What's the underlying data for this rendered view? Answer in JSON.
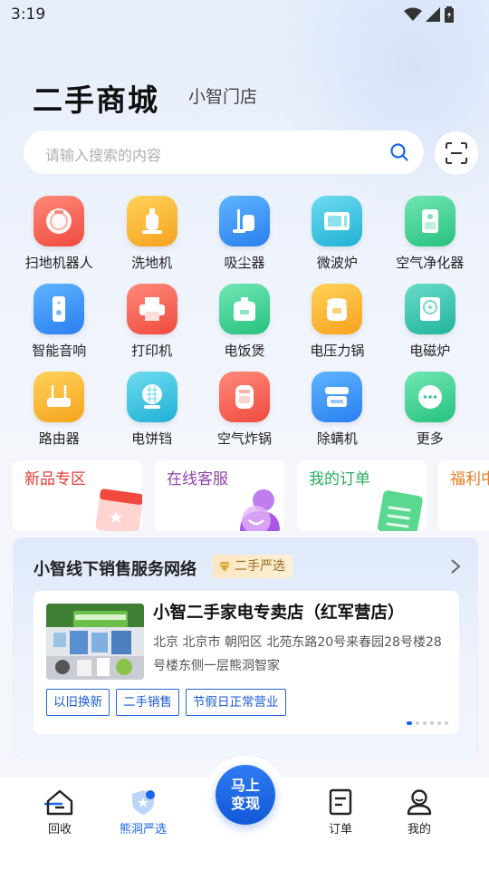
{
  "status": {
    "time": "3:19"
  },
  "header": {
    "title": "二手商城",
    "store": "小智门店"
  },
  "search": {
    "placeholder": "请输入搜索的内容"
  },
  "categories": [
    [
      {
        "label": "扫地机器人",
        "icon": "robot-vacuum-icon",
        "color": "#f0574a"
      },
      {
        "label": "洗地机",
        "icon": "floor-washer-icon",
        "color": "#f9a825"
      },
      {
        "label": "吸尘器",
        "icon": "vacuum-cleaner-icon",
        "color": "#2f8cf0"
      },
      {
        "label": "微波炉",
        "icon": "microwave-icon",
        "color": "#29b6d6"
      },
      {
        "label": "空气净化器",
        "icon": "air-purifier-icon",
        "color": "#2fc787"
      }
    ],
    [
      {
        "label": "智能音响",
        "icon": "smart-speaker-icon",
        "color": "#2f8cf0"
      },
      {
        "label": "打印机",
        "icon": "printer-icon",
        "color": "#f0574a"
      },
      {
        "label": "电饭煲",
        "icon": "rice-cooker-icon",
        "color": "#2fc787"
      },
      {
        "label": "电压力锅",
        "icon": "pressure-cooker-icon",
        "color": "#f9a825"
      },
      {
        "label": "电磁炉",
        "icon": "induction-cooker-icon",
        "color": "#29b6a8"
      }
    ],
    [
      {
        "label": "路由器",
        "icon": "router-icon",
        "color": "#f9a825"
      },
      {
        "label": "电饼铛",
        "icon": "electric-pan-icon",
        "color": "#29b6d6"
      },
      {
        "label": "空气炸锅",
        "icon": "air-fryer-icon",
        "color": "#f0574a"
      },
      {
        "label": "除螨机",
        "icon": "mite-remover-icon",
        "color": "#2f8cf0"
      },
      {
        "label": "更多",
        "icon": "more-icon",
        "color": "#2fc787"
      }
    ]
  ],
  "promos": [
    {
      "label": "新品专区",
      "color": "#e53935"
    },
    {
      "label": "在线客服",
      "color": "#8e44ad"
    },
    {
      "label": "我的订单",
      "color": "#27ae60"
    },
    {
      "label": "福利中心",
      "color": "#e67e22"
    }
  ],
  "network": {
    "title": "小智线下销售服务网络",
    "badge": "二手严选",
    "store": {
      "name": "小智二手家电专卖店（红军营店）",
      "address": "北京 北京市 朝阳区 北苑东路20号来春园28号楼28号楼东侧一层熊洞智家",
      "tags": [
        "以旧换新",
        "二手销售",
        "节假日正常营业"
      ]
    }
  },
  "nav": {
    "home": "回收",
    "select": "熊洞严选",
    "center_line1": "马上",
    "center_line2": "变现",
    "orders": "订单",
    "mine": "我的"
  },
  "colors": {
    "accent": "#1a66e8"
  }
}
